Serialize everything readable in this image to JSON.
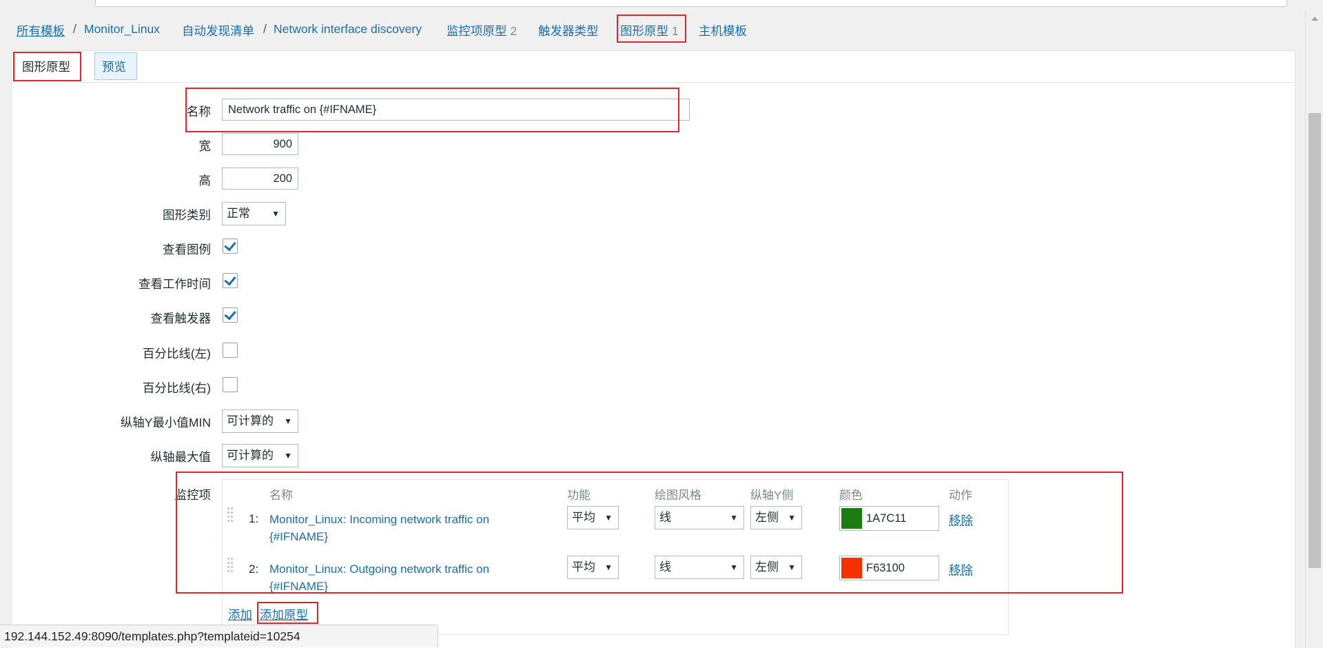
{
  "nav": {
    "all_templates": "所有模板",
    "template": "Monitor_Linux",
    "discovery_list": "自动发现清单",
    "discovery_rule": "Network interface discovery",
    "item_prototypes": "监控项原型",
    "item_prototypes_count": "2",
    "trigger_types": "触发器类型",
    "graph_prototypes": "图形原型",
    "graph_prototypes_count": "1",
    "host_templates": "主机模板"
  },
  "tabs": {
    "graph_prototype": "图形原型",
    "preview": "预览"
  },
  "form": {
    "name_label": "名称",
    "name_value": "Network traffic on {#IFNAME}",
    "width_label": "宽",
    "width_value": "900",
    "height_label": "高",
    "height_value": "200",
    "graph_type_label": "图形类别",
    "graph_type_value": "正常",
    "show_legend_label": "查看图例",
    "show_legend": true,
    "show_working_time_label": "查看工作时间",
    "show_working_time": true,
    "show_triggers_label": "查看触发器",
    "show_triggers": true,
    "percentile_left_label": "百分比线(左)",
    "percentile_left": false,
    "percentile_right_label": "百分比线(右)",
    "percentile_right": false,
    "ymin_label": "纵轴Y最小值MIN",
    "ymin_value": "可计算的",
    "ymax_label": "纵轴最大值",
    "ymax_value": "可计算的",
    "items_label": "监控项"
  },
  "items_table": {
    "headers": {
      "name": "名称",
      "function": "功能",
      "draw_style": "绘图风格",
      "y_axis_side": "纵轴Y侧",
      "color": "颜色",
      "action": "动作"
    },
    "rows": [
      {
        "index": "1:",
        "name_line1": "Monitor_Linux: Incoming network traffic on",
        "name_line2": "{#IFNAME}",
        "function": "平均",
        "draw_style": "线",
        "y_axis_side": "左侧",
        "color_hex": "1A7C11",
        "color": "#1A7C11",
        "action": "移除"
      },
      {
        "index": "2:",
        "name_line1": "Monitor_Linux: Outgoing network traffic on",
        "name_line2": "{#IFNAME}",
        "function": "平均",
        "draw_style": "线",
        "y_axis_side": "左侧",
        "color_hex": "F63100",
        "color": "#F63100",
        "action": "移除"
      }
    ],
    "add_label": "添加",
    "add_prototype_label": "添加原型"
  },
  "status_bar": {
    "url": "192.144.152.49:8090/templates.php?templateid=10254"
  },
  "icons": {
    "dropdown": "dropdown-arrow-icon",
    "checkbox": "checkmark-icon",
    "drag": "drag-handle-icon"
  },
  "colors": {
    "link": "#1a6ea8",
    "highlight_box": "#e0262b"
  }
}
